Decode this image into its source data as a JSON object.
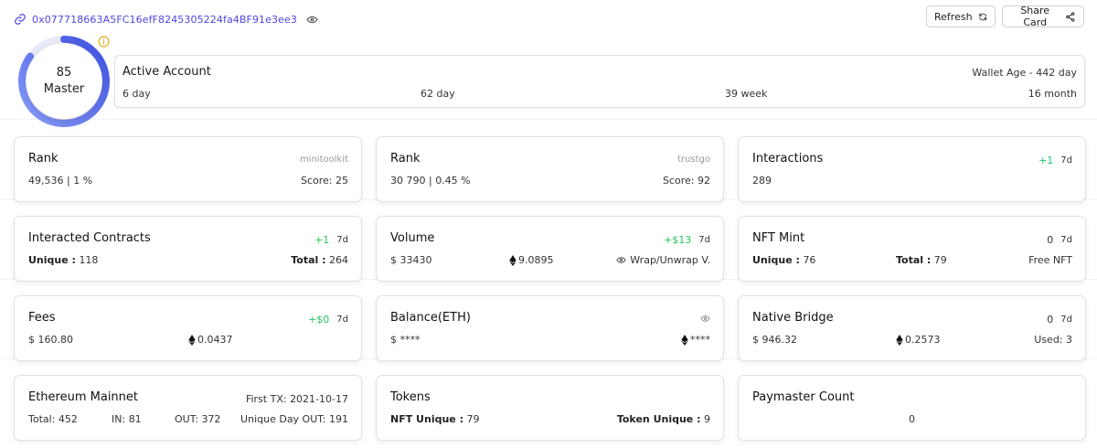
{
  "header": {
    "address": "0x077718663A5FC16efF8245305224fa4BF91e3ee3",
    "refresh_label": "Refresh",
    "share_label": "Share Card"
  },
  "score": {
    "value": "85",
    "level": "Master",
    "progress": 0.85
  },
  "active_account": {
    "title": "Active Account",
    "wallet_age": "Wallet Age - 442 day",
    "periods": [
      "6 day",
      "62 day",
      "39 week",
      "16 month"
    ]
  },
  "cards": {
    "rank_minitoolkit": {
      "title": "Rank",
      "source": "minitoolkit",
      "rank": "49,536 | 1 %",
      "score": "Score: 25"
    },
    "rank_trustgo": {
      "title": "Rank",
      "source": "trustgo",
      "rank": "30 790 | 0.45 %",
      "score": "Score: 92"
    },
    "interactions": {
      "title": "Interactions",
      "delta": "+1",
      "period": "7d",
      "value": "289"
    },
    "interacted_contracts": {
      "title": "Interacted Contracts",
      "delta": "+1",
      "period": "7d",
      "unique_label": "Unique :",
      "unique_value": "118",
      "total_label": "Total :",
      "total_value": "264"
    },
    "volume": {
      "title": "Volume",
      "delta": "+$13",
      "period": "7d",
      "usd": "$ 33430",
      "eth": "9.0895",
      "wrap_label": "Wrap/Unwrap V."
    },
    "nft_mint": {
      "title": "NFT Mint",
      "delta": "0",
      "period": "7d",
      "unique_label": "Unique :",
      "unique_value": "76",
      "total_label": "Total :",
      "total_value": "79",
      "free_label": "Free NFT"
    },
    "fees": {
      "title": "Fees",
      "delta": "+$0",
      "period": "7d",
      "usd": "$ 160.80",
      "eth": "0.0437"
    },
    "balance": {
      "title": "Balance(ETH)",
      "usd": "$ ****",
      "eth": "****"
    },
    "native_bridge": {
      "title": "Native Bridge",
      "delta": "0",
      "period": "7d",
      "usd": "$ 946.32",
      "eth": "0.2573",
      "used": "Used: 3"
    },
    "ethereum_mainnet": {
      "title": "Ethereum Mainnet",
      "first_tx_label": "First TX:",
      "first_tx": "2021-10-17",
      "total_label": "Total:",
      "total": "452",
      "in_label": "IN:",
      "in": "81",
      "out_label": "OUT:",
      "out": "372",
      "unique_out_label": "Unique Day OUT:",
      "unique_out": "191"
    },
    "tokens": {
      "title": "Tokens",
      "nft_unique_label": "NFT Unique :",
      "nft_unique": "79",
      "token_unique_label": "Token Unique :",
      "token_unique": "9"
    },
    "paymaster": {
      "title": "Paymaster Count",
      "value": "0"
    }
  },
  "colors": {
    "accent": "#4f46e5",
    "green": "#22c55e",
    "orange": "#fb8c4a",
    "info": "#e0a800"
  }
}
